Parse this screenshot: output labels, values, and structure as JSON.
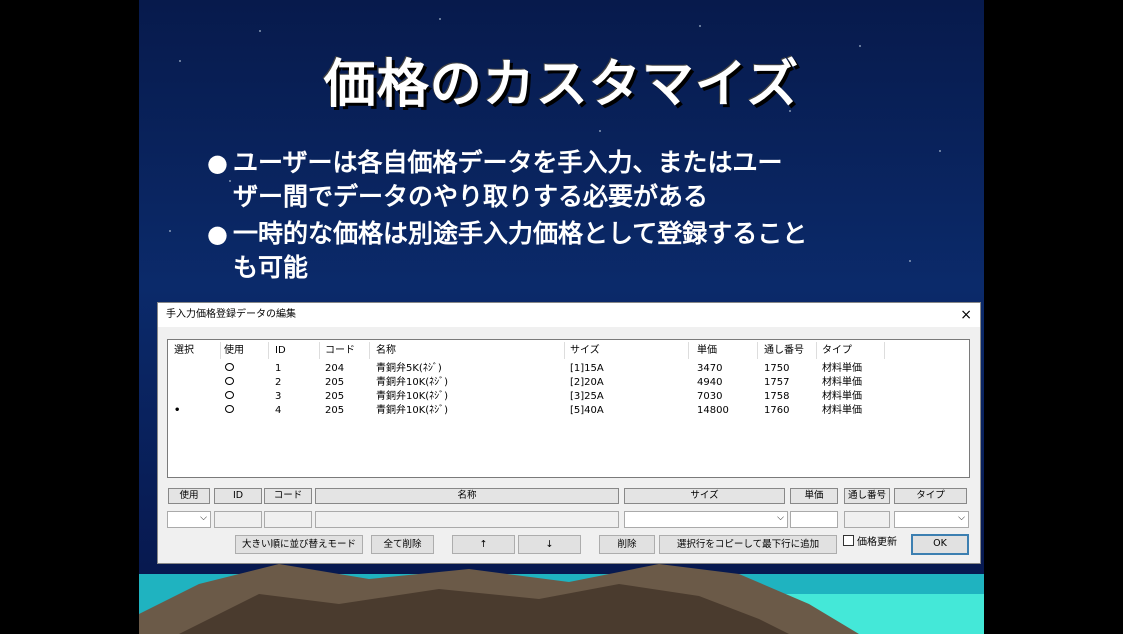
{
  "slide": {
    "title": "価格のカスタマイズ",
    "bullets": [
      {
        "marker": "●",
        "lines": [
          "ユーザーは各自価格データを手入力、またはユー",
          "ザー間でデータのやり取りする必要がある"
        ]
      },
      {
        "marker": "●",
        "lines": [
          "一時的な価格は別途手入力価格として登録すること",
          "も可能"
        ]
      }
    ]
  },
  "dialog": {
    "title": "手入力価格登録データの編集",
    "close": "×",
    "columns": [
      "選択",
      "使用",
      "ID",
      "コード",
      "名称",
      "サイズ",
      "単価",
      "通し番号",
      "タイプ"
    ],
    "rows": [
      {
        "select": "",
        "id": "1",
        "code": "204",
        "name": "青銅弁5K(ﾈｼﾞ)",
        "size": "[1]15A",
        "price": "3470",
        "serial": "1750",
        "type": "材料単価"
      },
      {
        "select": "",
        "id": "2",
        "code": "205",
        "name": "青銅弁10K(ﾈｼﾞ)",
        "size": "[2]20A",
        "price": "4940",
        "serial": "1757",
        "type": "材料単価"
      },
      {
        "select": "",
        "id": "3",
        "code": "205",
        "name": "青銅弁10K(ﾈｼﾞ)",
        "size": "[3]25A",
        "price": "7030",
        "serial": "1758",
        "type": "材料単価"
      },
      {
        "select": "•",
        "id": "4",
        "code": "205",
        "name": "青銅弁10K(ﾈｼﾞ)",
        "size": "[5]40A",
        "price": "14800",
        "serial": "1760",
        "type": "材料単価"
      }
    ],
    "edit_labels": {
      "use": "使用",
      "id": "ID",
      "code": "コード",
      "name": "名称",
      "size": "サイズ",
      "price": "単価",
      "serial": "通し番号",
      "type": "タイプ"
    },
    "buttons": {
      "sort": "大きい順に並び替えモード",
      "delete_all": "全て削除",
      "up": "↑",
      "down": "↓",
      "delete": "削除",
      "copy_append": "選択行をコピーして最下行に追加",
      "price_update": "価格更新",
      "ok": "OK"
    },
    "price_update_checked": false
  }
}
